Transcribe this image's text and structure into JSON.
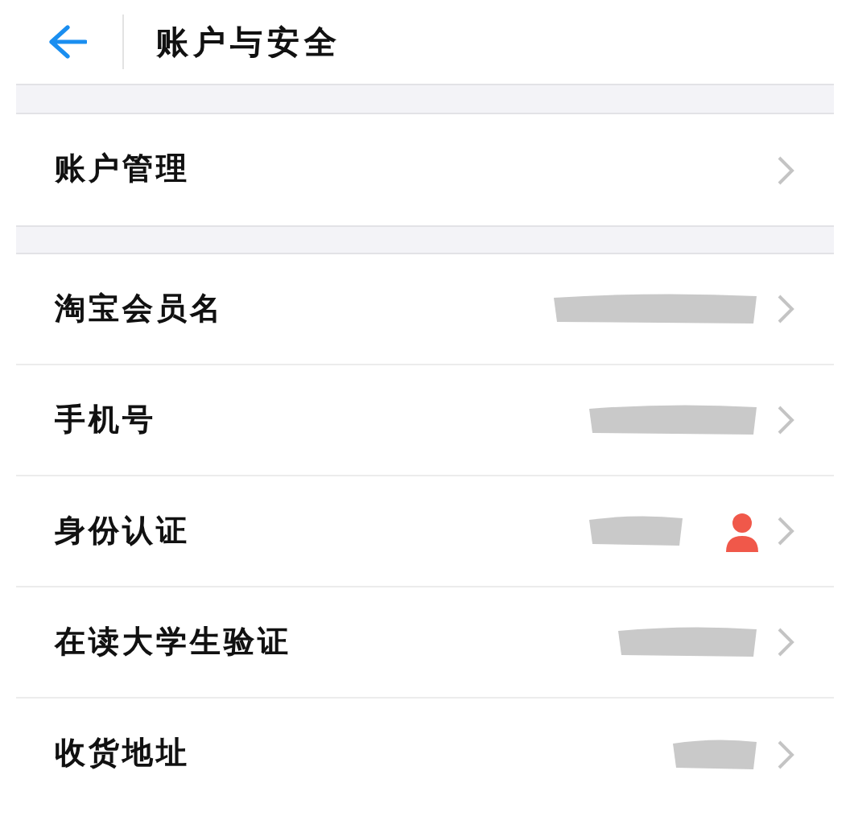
{
  "header": {
    "title": "账户与安全"
  },
  "groups": [
    {
      "items": [
        {
          "label": "账户管理",
          "redacted": false,
          "person_badge": false
        }
      ]
    },
    {
      "items": [
        {
          "label": "淘宝会员名",
          "redacted": true,
          "person_badge": false
        },
        {
          "label": "手机号",
          "redacted": true,
          "person_badge": false
        },
        {
          "label": "身份认证",
          "redacted": true,
          "person_badge": true
        },
        {
          "label": "在读大学生验证",
          "redacted": true,
          "person_badge": false
        },
        {
          "label": "收货地址",
          "redacted": true,
          "person_badge": false
        }
      ]
    }
  ]
}
